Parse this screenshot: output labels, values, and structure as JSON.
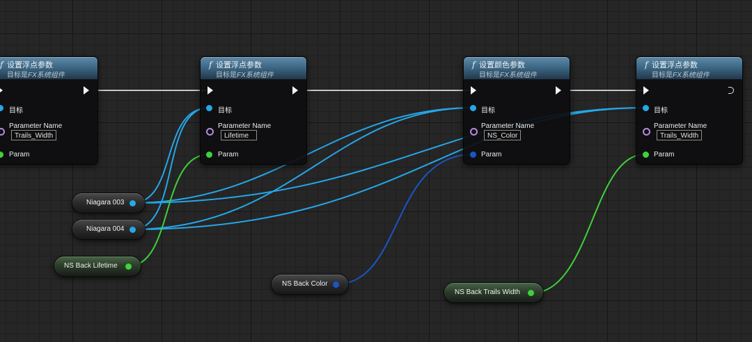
{
  "colors": {
    "object_pin": "#25a7ea",
    "color_pin": "#1a55c8",
    "float_pin": "#3fd23a",
    "name_pin": "#b48be0",
    "exec_wire": "#c8c8c8"
  },
  "nodes": [
    {
      "title": "设置浮点参数",
      "subtitle_prefix": "目标是",
      "subtitle_em": "FX系统组件",
      "target_label": "目标",
      "param_name_label": "Parameter Name",
      "param_name_value": "Trails_Width",
      "param_label": "Param"
    },
    {
      "title": "设置浮点参数",
      "subtitle_prefix": "目标是",
      "subtitle_em": "FX系统组件",
      "target_label": "目标",
      "param_name_label": "Parameter Name",
      "param_name_value": "Lifetime",
      "param_label": "Param"
    },
    {
      "title": "设置颜色参数",
      "subtitle_prefix": "目标是",
      "subtitle_em": "FX系统组件",
      "target_label": "目标",
      "param_name_label": "Parameter Name",
      "param_name_value": "NS_Color",
      "param_label": "Param"
    },
    {
      "title": "设置浮点参数",
      "subtitle_prefix": "目标是",
      "subtitle_em": "FX系统组件",
      "target_label": "目标",
      "param_name_label": "Parameter Name",
      "param_name_value": "Trails_Width",
      "param_label": "Param"
    }
  ],
  "variables": [
    {
      "label": "Niagara 003"
    },
    {
      "label": "Niagara 004"
    },
    {
      "label": "NS Back Lifetime"
    },
    {
      "label": "NS Back Color"
    },
    {
      "label": "NS Back Trails Width"
    }
  ]
}
